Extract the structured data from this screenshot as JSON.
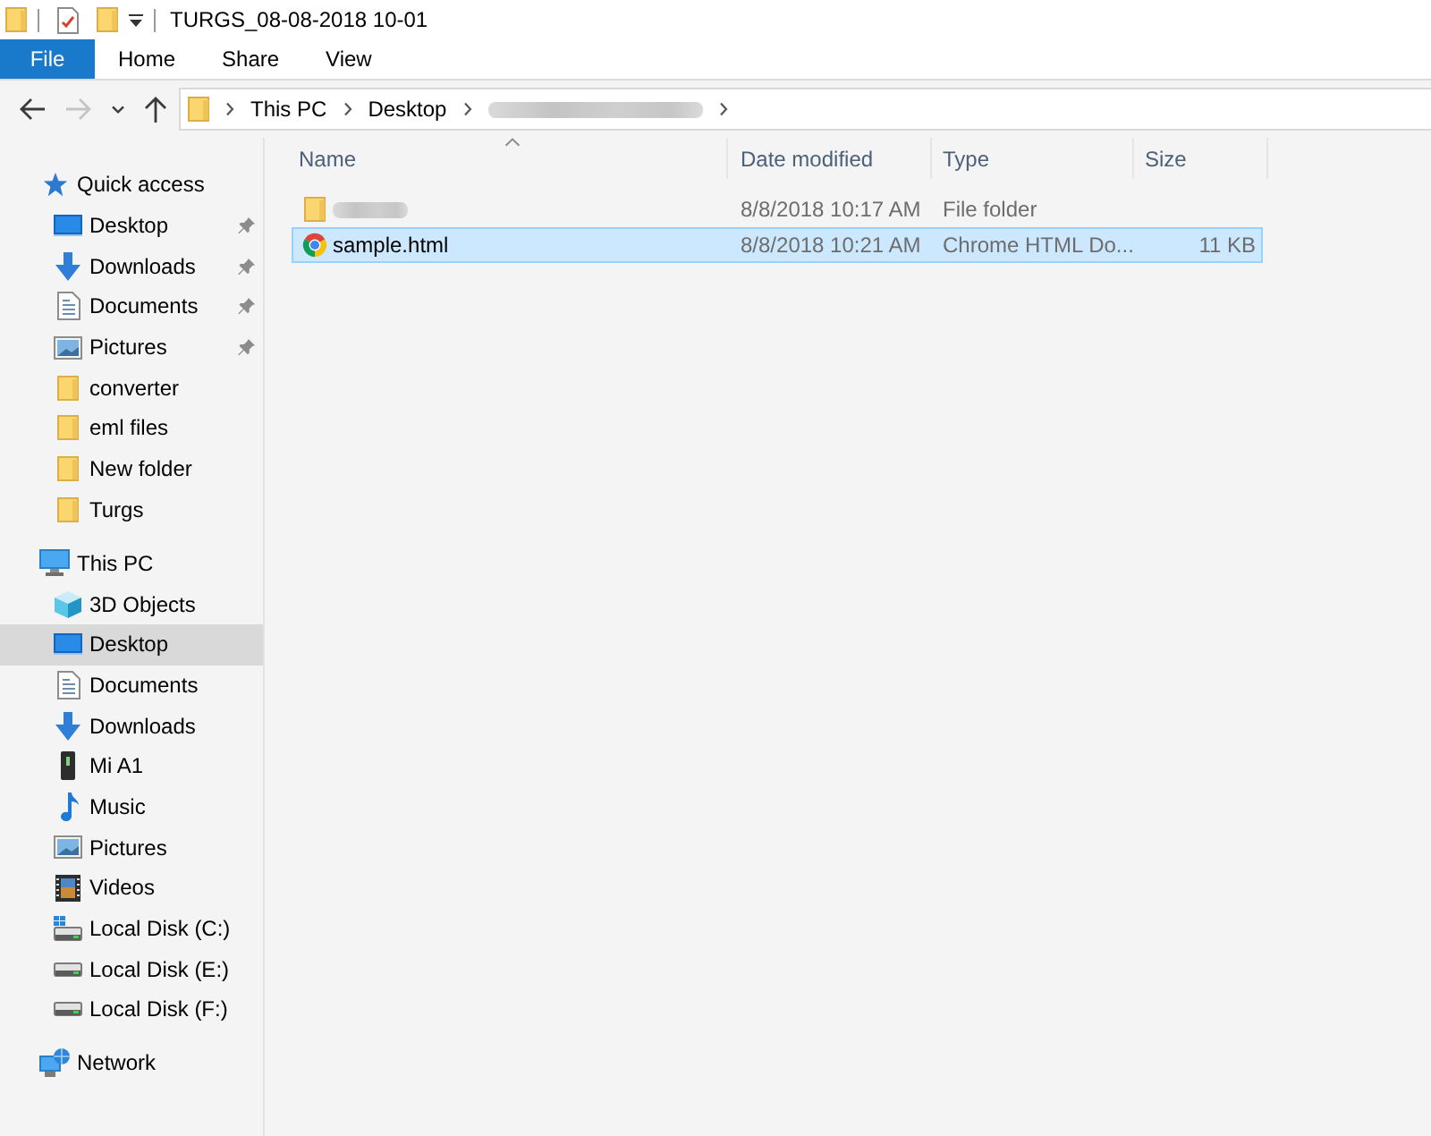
{
  "window": {
    "title": "TURGS_08-08-2018 10-01"
  },
  "ribbon_tabs": [
    {
      "label": "File",
      "kind": "file",
      "selected": false
    },
    {
      "label": "Home",
      "kind": "tab",
      "selected": false
    },
    {
      "label": "Share",
      "kind": "tab",
      "selected": false
    },
    {
      "label": "View",
      "kind": "tab",
      "selected": false
    }
  ],
  "nav_buttons": [
    {
      "kind": "back",
      "disabled": false
    },
    {
      "kind": "forward",
      "disabled": true
    },
    {
      "kind": "recent",
      "disabled": false
    },
    {
      "kind": "up",
      "disabled": false
    }
  ],
  "address": {
    "path": [
      {
        "label": "This PC",
        "blurred": false
      },
      {
        "label": "Desktop",
        "blurred": false
      },
      {
        "blurred": true
      }
    ]
  },
  "navigation": [
    {
      "label": "Quick access",
      "kind": "quickaccess",
      "selected": false,
      "children": [
        {
          "label": "Desktop",
          "kind": "desktop",
          "pinned": true,
          "selected": false
        },
        {
          "label": "Downloads",
          "kind": "downloads",
          "pinned": true,
          "selected": false
        },
        {
          "label": "Documents",
          "kind": "documents",
          "pinned": true,
          "selected": false
        },
        {
          "label": "Pictures",
          "kind": "pictures",
          "pinned": true,
          "selected": false
        },
        {
          "label": "converter",
          "kind": "folder",
          "pinned": false,
          "selected": false
        },
        {
          "label": "eml files",
          "kind": "folder",
          "pinned": false,
          "selected": false
        },
        {
          "label": "New folder",
          "kind": "folder",
          "pinned": false,
          "selected": false
        },
        {
          "label": "Turgs",
          "kind": "folder",
          "pinned": false,
          "selected": false
        }
      ]
    },
    {
      "label": "This PC",
      "kind": "pc",
      "selected": false,
      "children": [
        {
          "label": "3D Objects",
          "kind": "objects",
          "selected": false
        },
        {
          "label": "Desktop",
          "kind": "desktop",
          "selected": true
        },
        {
          "label": "Documents",
          "kind": "documents",
          "selected": false
        },
        {
          "label": "Downloads",
          "kind": "downloads",
          "selected": false
        },
        {
          "label": "Mi A1",
          "kind": "phone",
          "selected": false
        },
        {
          "label": "Music",
          "kind": "music",
          "selected": false
        },
        {
          "label": "Pictures",
          "kind": "pictures",
          "selected": false
        },
        {
          "label": "Videos",
          "kind": "videos",
          "selected": false
        },
        {
          "label": "Local Disk (C:)",
          "kind": "systemdisk",
          "selected": false
        },
        {
          "label": "Local Disk (E:)",
          "kind": "disk",
          "selected": false
        },
        {
          "label": "Local Disk (F:)",
          "kind": "disk",
          "selected": false
        }
      ]
    },
    {
      "label": "Network",
      "kind": "network",
      "selected": false
    }
  ],
  "file_list": {
    "columns": [
      {
        "label": "Name",
        "sorted": true
      },
      {
        "label": "Date modified",
        "sorted": false
      },
      {
        "label": "Type",
        "sorted": false
      },
      {
        "label": "Size",
        "sorted": false
      }
    ],
    "rows": [
      {
        "kind": "folder",
        "name_blurred": true,
        "date_modified": "8/8/2018 10:17 AM",
        "type": "File folder",
        "selected": false
      },
      {
        "kind": "html",
        "name_blurred": false,
        "name": "sample.html",
        "date_modified": "8/8/2018 10:21 AM",
        "type": "Chrome HTML Do...",
        "size": "11 KB",
        "selected": true
      }
    ]
  }
}
